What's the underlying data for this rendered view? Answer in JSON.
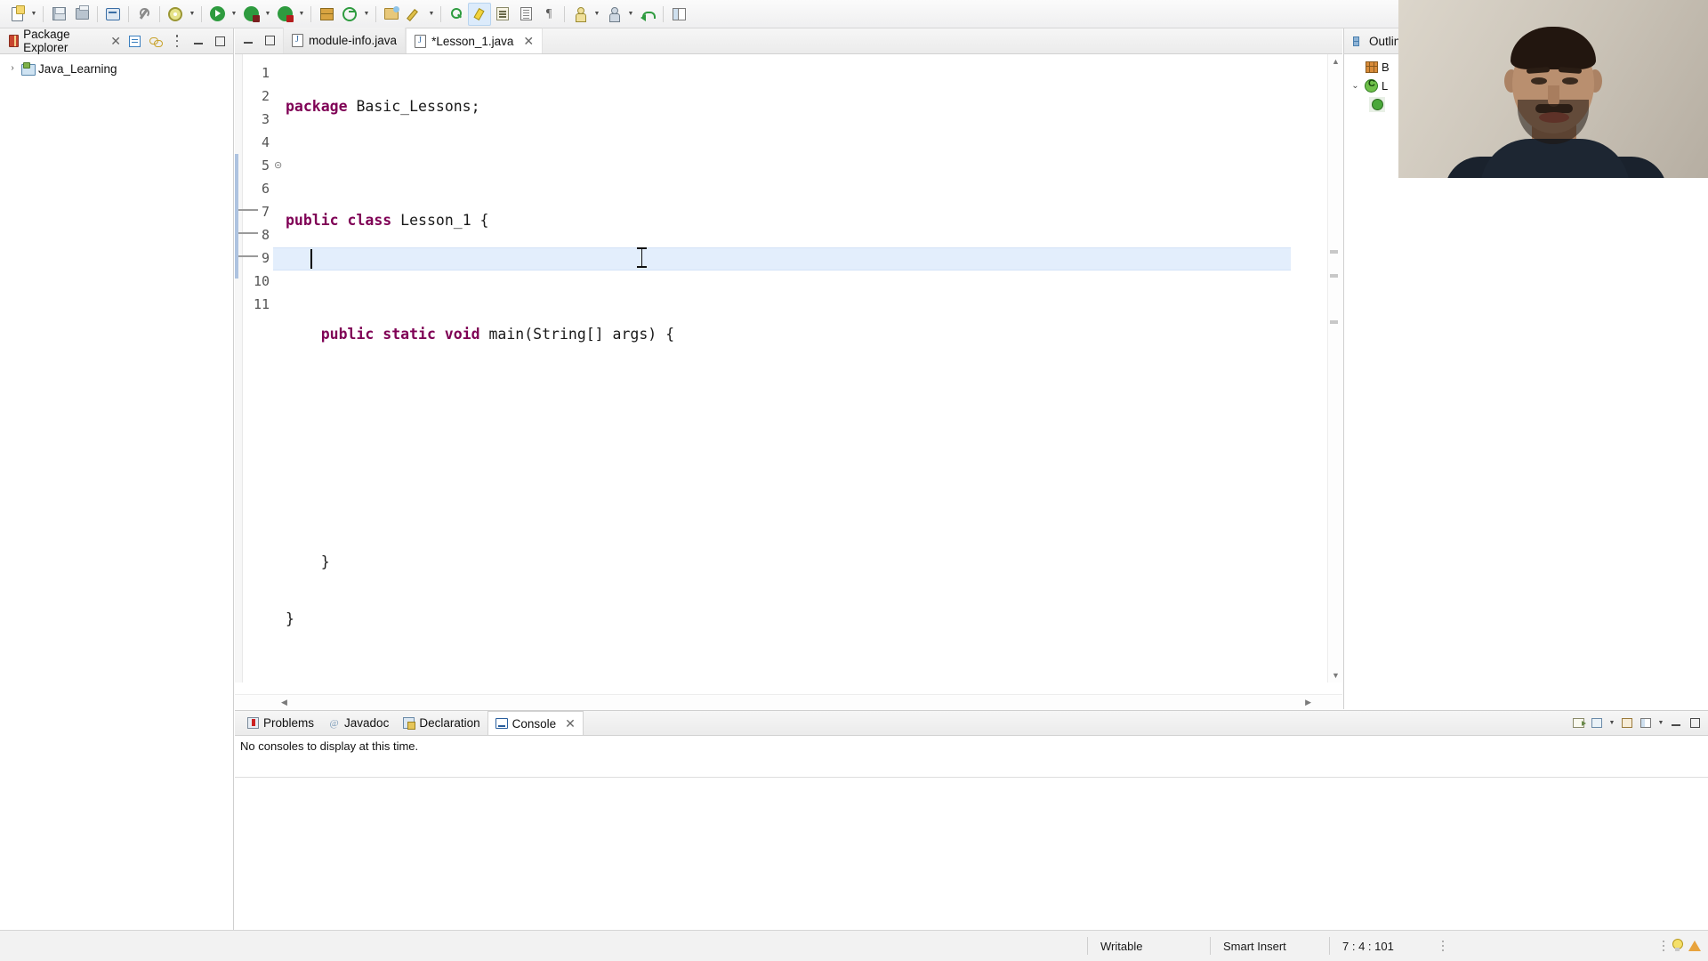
{
  "toolbar": {
    "items": [
      {
        "name": "new-wizard-button",
        "icon": "new-document-icon",
        "dropdown": true,
        "active": false
      },
      {
        "name": "save-button",
        "icon": "save-icon",
        "dropdown": false,
        "active": false
      },
      {
        "name": "print-button",
        "icon": "print-icon",
        "dropdown": false,
        "active": false
      },
      {
        "name": "open-terminal-button",
        "icon": "terminal-icon",
        "dropdown": false,
        "active": false
      },
      {
        "name": "build-all-button",
        "icon": "hammer-icon",
        "dropdown": false,
        "active": false
      },
      {
        "name": "external-tools-button",
        "icon": "gear-icon",
        "dropdown": true,
        "active": false
      },
      {
        "name": "run-button",
        "icon": "run-green-play-icon",
        "dropdown": true,
        "active": false
      },
      {
        "name": "debug-button",
        "icon": "debug-bug-icon",
        "dropdown": true,
        "active": false
      },
      {
        "name": "coverage-button",
        "icon": "coverage-bug-icon",
        "dropdown": true,
        "active": false
      },
      {
        "name": "new-java-package-button",
        "icon": "package-icon",
        "dropdown": false,
        "active": false
      },
      {
        "name": "new-java-class-button",
        "icon": "java-class-circle-icon",
        "dropdown": true,
        "active": false
      },
      {
        "name": "open-type-button",
        "icon": "open-folder-icon",
        "dropdown": false,
        "active": false
      },
      {
        "name": "search-button",
        "icon": "pencil-search-icon",
        "dropdown": true,
        "active": false
      },
      {
        "name": "open-task-button",
        "icon": "green-search-icon",
        "dropdown": false,
        "active": false
      },
      {
        "name": "toggle-mark-occurrences-button",
        "icon": "highlighter-icon",
        "dropdown": false,
        "active": true
      },
      {
        "name": "next-annotation-button",
        "icon": "next-annotation-icon",
        "dropdown": false,
        "active": false
      },
      {
        "name": "previous-annotation-button",
        "icon": "previous-annotation-icon",
        "dropdown": false,
        "active": false
      },
      {
        "name": "show-whitespace-button",
        "icon": "pilcrow-icon",
        "dropdown": false,
        "active": false
      },
      {
        "name": "last-edit-location-button",
        "icon": "person-yellow-icon",
        "dropdown": true,
        "active": false
      },
      {
        "name": "back-navigation-button",
        "icon": "person-icon",
        "dropdown": true,
        "active": false
      },
      {
        "name": "forward-navigation-button",
        "icon": "back-arrow-green-icon",
        "dropdown": false,
        "active": false
      },
      {
        "name": "open-perspective-button",
        "icon": "perspective-icon",
        "dropdown": false,
        "active": false
      }
    ]
  },
  "package_explorer": {
    "title": "Package Explorer",
    "close_label": "✕",
    "icon": "package-explorer-icon",
    "actions": [
      {
        "name": "collapse-all-button",
        "icon": "collapse-all-icon"
      },
      {
        "name": "link-with-editor-button",
        "icon": "link-editor-icon"
      },
      {
        "name": "view-menu-button",
        "icon": "view-menu-icon"
      },
      {
        "name": "minimize-view-button",
        "icon": "minimize-icon"
      },
      {
        "name": "maximize-view-button",
        "icon": "maximize-icon"
      }
    ],
    "tree": [
      {
        "label": "Java_Learning",
        "chevron": "›",
        "icon": "java-project-icon",
        "expanded": false
      }
    ]
  },
  "editor": {
    "tabs": [
      {
        "label": "module-info.java",
        "icon": "java-file-icon",
        "active": false,
        "dirty": false,
        "closable": false
      },
      {
        "label": "*Lesson_1.java",
        "icon": "java-file-icon",
        "active": true,
        "dirty": true,
        "closable": true,
        "close_label": "✕"
      }
    ],
    "restore_label": "—",
    "maximize_label": "□",
    "line_numbers": [
      "1",
      "2",
      "3",
      "4",
      "5",
      "6",
      "7",
      "8",
      "9",
      "10",
      "11"
    ],
    "fold_marker_line": 5,
    "fold_marker": "⊝",
    "current_line": 7,
    "lines": [
      {
        "n": 1,
        "tokens": [
          {
            "t": "package",
            "k": true
          },
          {
            "t": " Basic_Lessons;",
            "k": false
          }
        ]
      },
      {
        "n": 2,
        "tokens": []
      },
      {
        "n": 3,
        "tokens": [
          {
            "t": "public class",
            "k": true
          },
          {
            "t": " Lesson_1 {",
            "k": false
          }
        ]
      },
      {
        "n": 4,
        "tokens": []
      },
      {
        "n": 5,
        "tokens": [
          {
            "t": "    public static void",
            "k": true
          },
          {
            "t": " main(String[] args) {",
            "k": false
          }
        ]
      },
      {
        "n": 6,
        "tokens": []
      },
      {
        "n": 7,
        "tokens": []
      },
      {
        "n": 8,
        "tokens": []
      },
      {
        "n": 9,
        "tokens": [
          {
            "t": "    }",
            "k": false
          }
        ]
      },
      {
        "n": 10,
        "tokens": [
          {
            "t": "}",
            "k": false
          }
        ]
      },
      {
        "n": 11,
        "tokens": []
      }
    ],
    "scroll_up": "▲",
    "scroll_down": "▼",
    "scroll_left": "◀",
    "scroll_right": "▶"
  },
  "outline": {
    "title": "Outline",
    "icon": "outline-icon",
    "tree": [
      {
        "label": "B",
        "icon": "package-declaration-icon",
        "chevron": "",
        "indent": 1
      },
      {
        "label": "L",
        "icon": "java-class-icon",
        "chevron": "⌄",
        "indent": 0
      },
      {
        "label": "",
        "icon": "java-method-icon",
        "chevron": "",
        "indent": 2
      }
    ]
  },
  "console": {
    "tabs": [
      {
        "label": "Problems",
        "icon": "problems-icon",
        "active": false,
        "closable": false
      },
      {
        "label": "Javadoc",
        "icon": "javadoc-icon",
        "active": false,
        "closable": false
      },
      {
        "label": "Declaration",
        "icon": "declaration-icon",
        "active": false,
        "closable": false
      },
      {
        "label": "Console",
        "icon": "console-icon",
        "active": true,
        "closable": true,
        "close_label": "✕"
      }
    ],
    "message": "No consoles to display at this time.",
    "actions": [
      {
        "name": "clear-console-button",
        "icon": "clear-console-icon"
      },
      {
        "name": "scroll-lock-button",
        "icon": "scroll-lock-icon"
      },
      {
        "name": "pin-console-button",
        "icon": "pin-console-icon"
      },
      {
        "name": "display-selected-console-button",
        "icon": "display-console-icon"
      },
      {
        "name": "open-console-button",
        "icon": "open-console-icon"
      },
      {
        "name": "minimize-console-button",
        "icon": "minimize-icon"
      },
      {
        "name": "maximize-console-button",
        "icon": "maximize-icon"
      }
    ]
  },
  "statusbar": {
    "writable": "Writable",
    "insert_mode": "Smart Insert",
    "cursor_position": "7 : 4 : 101"
  }
}
